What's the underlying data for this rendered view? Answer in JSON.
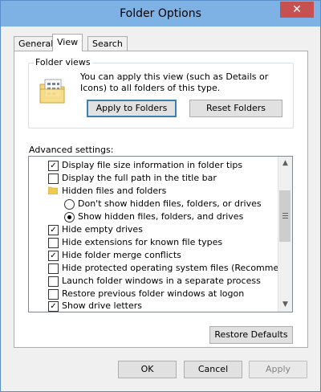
{
  "window": {
    "title": "Folder Options"
  },
  "tabs": [
    {
      "label": "General"
    },
    {
      "label": "View"
    },
    {
      "label": "Search"
    }
  ],
  "folder_views": {
    "group_label": "Folder views",
    "text": "You can apply this view (such as Details or Icons) to all folders of this type.",
    "apply_label": "Apply to Folders",
    "reset_label": "Reset Folders"
  },
  "advanced": {
    "label": "Advanced settings:",
    "items": [
      {
        "kind": "checkbox",
        "checked": true,
        "label": "Display file size information in folder tips"
      },
      {
        "kind": "checkbox",
        "checked": false,
        "label": "Display the full path in the title bar"
      },
      {
        "kind": "folder",
        "label": "Hidden files and folders"
      },
      {
        "kind": "radio",
        "checked": false,
        "label": "Don't show hidden files, folders, or drives"
      },
      {
        "kind": "radio",
        "checked": true,
        "label": "Show hidden files, folders, and drives"
      },
      {
        "kind": "checkbox",
        "checked": true,
        "label": "Hide empty drives"
      },
      {
        "kind": "checkbox",
        "checked": false,
        "label": "Hide extensions for known file types"
      },
      {
        "kind": "checkbox",
        "checked": true,
        "label": "Hide folder merge conflicts"
      },
      {
        "kind": "checkbox",
        "checked": false,
        "label": "Hide protected operating system files (Recommended)"
      },
      {
        "kind": "checkbox",
        "checked": false,
        "label": "Launch folder windows in a separate process"
      },
      {
        "kind": "checkbox",
        "checked": false,
        "label": "Restore previous folder windows at logon"
      },
      {
        "kind": "checkbox",
        "checked": true,
        "label": "Show drive letters"
      }
    ],
    "restore_defaults_label": "Restore Defaults"
  },
  "footer": {
    "ok_label": "OK",
    "cancel_label": "Cancel",
    "apply_label": "Apply"
  },
  "colors": {
    "titlebar": "#7fb2e4",
    "close": "#c75050",
    "accent": "#3c7fb1"
  }
}
